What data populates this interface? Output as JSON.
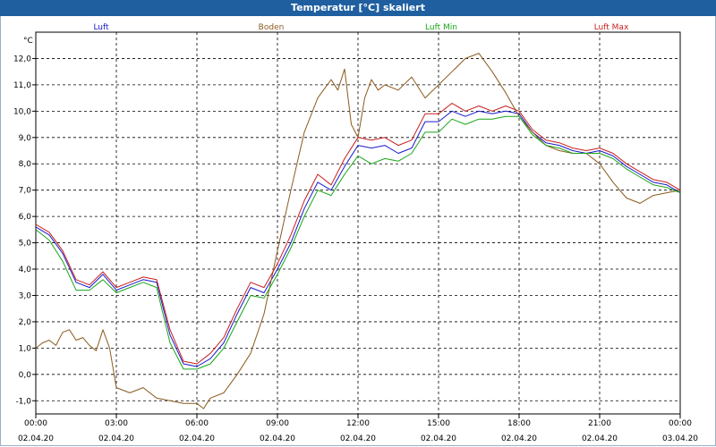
{
  "window": {
    "title": "Temperatur [°C] skaliert"
  },
  "chart_data": {
    "type": "line",
    "title": "Temperatur [°C] skaliert",
    "ylabel": "°C",
    "xlabel": "",
    "x_range": [
      "02.04.20 00:00",
      "03.04.20 00:00"
    ],
    "ylim": [
      -1.5,
      13
    ],
    "y_ticks": [
      "-1,0",
      "0,0",
      "1,0",
      "2,0",
      "3,0",
      "4,0",
      "5,0",
      "6,0",
      "7,0",
      "8,0",
      "9,0",
      "10,0",
      "11,0",
      "12,0"
    ],
    "x_ticks": [
      {
        "time": "00:00",
        "date": "02.04.20"
      },
      {
        "time": "03:00",
        "date": "02.04.20"
      },
      {
        "time": "06:00",
        "date": "02.04.20"
      },
      {
        "time": "09:00",
        "date": "02.04.20"
      },
      {
        "time": "12:00",
        "date": "02.04.20"
      },
      {
        "time": "15:00",
        "date": "02.04.20"
      },
      {
        "time": "18:00",
        "date": "02.04.20"
      },
      {
        "time": "21:00",
        "date": "02.04.20"
      },
      {
        "time": "00:00",
        "date": "03.04.20"
      }
    ],
    "grid": true,
    "legend_position": "top",
    "series": [
      {
        "name": "Luft",
        "color": "#1a1acc",
        "x": [
          "00:00",
          "00:30",
          "01:00",
          "01:30",
          "02:00",
          "02:30",
          "03:00",
          "03:30",
          "04:00",
          "04:30",
          "05:00",
          "05:30",
          "06:00",
          "06:30",
          "07:00",
          "07:30",
          "08:00",
          "08:30",
          "09:00",
          "09:30",
          "10:00",
          "10:30",
          "11:00",
          "11:30",
          "12:00",
          "12:30",
          "13:00",
          "13:30",
          "14:00",
          "14:30",
          "15:00",
          "15:30",
          "16:00",
          "16:30",
          "17:00",
          "17:30",
          "18:00",
          "18:30",
          "19:00",
          "19:30",
          "20:00",
          "20:30",
          "21:00",
          "21:30",
          "22:00",
          "22:30",
          "23:00",
          "23:30",
          "24:00"
        ],
        "values": [
          5.6,
          5.3,
          4.6,
          3.5,
          3.3,
          3.8,
          3.2,
          3.4,
          3.6,
          3.5,
          1.5,
          0.4,
          0.3,
          0.6,
          1.2,
          2.3,
          3.3,
          3.1,
          4.0,
          5.0,
          6.3,
          7.3,
          7.0,
          7.9,
          8.7,
          8.6,
          8.7,
          8.4,
          8.6,
          9.6,
          9.6,
          10.0,
          9.8,
          10.0,
          9.9,
          10.0,
          9.9,
          9.2,
          8.8,
          8.7,
          8.5,
          8.4,
          8.5,
          8.3,
          7.9,
          7.6,
          7.3,
          7.2,
          6.9
        ]
      },
      {
        "name": "Boden",
        "color": "#8b5a1e",
        "x": [
          "00:00",
          "00:15",
          "00:30",
          "00:45",
          "01:00",
          "01:15",
          "01:30",
          "01:45",
          "02:00",
          "02:15",
          "02:30",
          "02:45",
          "03:00",
          "03:30",
          "04:00",
          "04:30",
          "05:00",
          "05:30",
          "06:00",
          "06:15",
          "06:30",
          "07:00",
          "07:30",
          "08:00",
          "08:30",
          "09:00",
          "09:30",
          "10:00",
          "10:30",
          "11:00",
          "11:15",
          "11:30",
          "11:45",
          "12:00",
          "12:15",
          "12:30",
          "12:45",
          "13:00",
          "13:30",
          "14:00",
          "14:30",
          "15:00",
          "15:30",
          "16:00",
          "16:30",
          "17:00",
          "17:30",
          "18:00",
          "18:30",
          "19:00",
          "19:30",
          "20:00",
          "20:30",
          "21:00",
          "21:30",
          "22:00",
          "22:30",
          "23:00",
          "23:30",
          "24:00"
        ],
        "values": [
          1.0,
          1.2,
          1.3,
          1.1,
          1.6,
          1.7,
          1.3,
          1.4,
          1.1,
          0.9,
          1.7,
          1.0,
          -0.5,
          -0.7,
          -0.5,
          -0.9,
          -1.0,
          -1.1,
          -1.1,
          -1.3,
          -0.9,
          -0.7,
          0.0,
          0.8,
          2.3,
          4.7,
          7.0,
          9.2,
          10.5,
          11.2,
          10.8,
          11.6,
          9.5,
          9.0,
          10.5,
          11.2,
          10.8,
          11.0,
          10.8,
          11.3,
          10.5,
          11.0,
          11.5,
          12.0,
          12.2,
          11.5,
          10.7,
          9.8,
          9.2,
          8.7,
          8.5,
          8.4,
          8.4,
          8.0,
          7.3,
          6.7,
          6.5,
          6.8,
          6.9,
          7.0
        ]
      },
      {
        "name": "Luft Min",
        "color": "#19a519",
        "x": [
          "00:00",
          "00:30",
          "01:00",
          "01:30",
          "02:00",
          "02:30",
          "03:00",
          "03:30",
          "04:00",
          "04:30",
          "05:00",
          "05:30",
          "06:00",
          "06:30",
          "07:00",
          "07:30",
          "08:00",
          "08:30",
          "09:00",
          "09:30",
          "10:00",
          "10:30",
          "11:00",
          "11:30",
          "12:00",
          "12:30",
          "13:00",
          "13:30",
          "14:00",
          "14:30",
          "15:00",
          "15:30",
          "16:00",
          "16:30",
          "17:00",
          "17:30",
          "18:00",
          "18:30",
          "19:00",
          "19:30",
          "20:00",
          "20:30",
          "21:00",
          "21:30",
          "22:00",
          "22:30",
          "23:00",
          "23:30",
          "24:00"
        ],
        "values": [
          5.5,
          5.1,
          4.3,
          3.2,
          3.2,
          3.6,
          3.1,
          3.3,
          3.5,
          3.3,
          1.2,
          0.2,
          0.2,
          0.4,
          1.0,
          2.0,
          3.0,
          2.9,
          3.8,
          4.8,
          6.0,
          7.0,
          6.8,
          7.6,
          8.3,
          8.0,
          8.2,
          8.1,
          8.4,
          9.2,
          9.2,
          9.7,
          9.5,
          9.7,
          9.7,
          9.8,
          9.8,
          9.1,
          8.7,
          8.6,
          8.4,
          8.4,
          8.4,
          8.2,
          7.8,
          7.5,
          7.2,
          7.1,
          6.9
        ]
      },
      {
        "name": "Luft Max",
        "color": "#c81e1e",
        "x": [
          "00:00",
          "00:30",
          "01:00",
          "01:30",
          "02:00",
          "02:30",
          "03:00",
          "03:30",
          "04:00",
          "04:30",
          "05:00",
          "05:30",
          "06:00",
          "06:30",
          "07:00",
          "07:30",
          "08:00",
          "08:30",
          "09:00",
          "09:30",
          "10:00",
          "10:30",
          "11:00",
          "11:30",
          "12:00",
          "12:30",
          "13:00",
          "13:30",
          "14:00",
          "14:30",
          "15:00",
          "15:30",
          "16:00",
          "16:30",
          "17:00",
          "17:30",
          "18:00",
          "18:30",
          "19:00",
          "19:30",
          "20:00",
          "20:30",
          "21:00",
          "21:30",
          "22:00",
          "22:30",
          "23:00",
          "23:30",
          "24:00"
        ],
        "values": [
          5.7,
          5.4,
          4.7,
          3.6,
          3.4,
          3.9,
          3.3,
          3.5,
          3.7,
          3.6,
          1.7,
          0.5,
          0.4,
          0.8,
          1.4,
          2.5,
          3.5,
          3.3,
          4.2,
          5.3,
          6.6,
          7.6,
          7.2,
          8.2,
          9.0,
          8.9,
          9.0,
          8.7,
          8.9,
          9.9,
          9.9,
          10.3,
          10.0,
          10.2,
          10.0,
          10.2,
          10.0,
          9.3,
          8.9,
          8.8,
          8.6,
          8.5,
          8.6,
          8.4,
          8.0,
          7.7,
          7.4,
          7.3,
          7.0
        ]
      }
    ]
  }
}
